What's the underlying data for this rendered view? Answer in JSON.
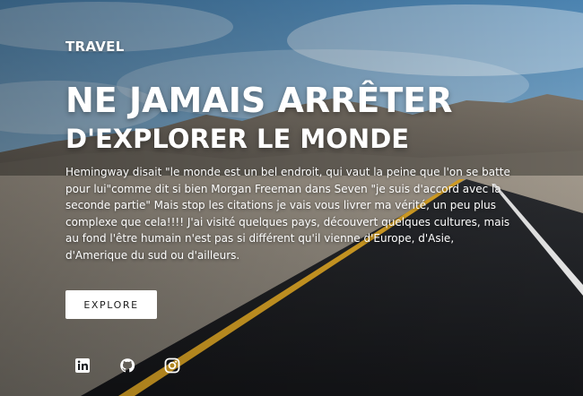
{
  "hero": {
    "category": "TRAVEL",
    "title_line1": "NE JAMAIS ARRÊTER",
    "title_line2": "D'EXPLORER LE MONDE",
    "description": "Hemingway disait \"le monde est un bel endroit, qui vaut la peine que l'on se batte pour lui\"comme dit si bien Morgan Freeman dans Seven \"je suis d'accord avec la seconde partie\" Mais stop les citations je vais vous livrer ma vérité, un peu plus complexe que cela!!!! J'ai visité quelques pays, découvert quelques cultures, mais au fond l'être humain n'est pas si différent qu'il vienne d'Europe, d'Asie, d'Amerique du sud ou d'ailleurs.",
    "cta_label": "EXPLORE"
  },
  "socials": [
    {
      "icon": "linkedin-icon"
    },
    {
      "icon": "github-icon"
    },
    {
      "icon": "instagram-icon"
    }
  ],
  "colors": {
    "text": "#ffffff",
    "button_bg": "#ffffff",
    "button_text": "#202020",
    "road_line": "#e0a826",
    "sky": "#4d86b4"
  }
}
